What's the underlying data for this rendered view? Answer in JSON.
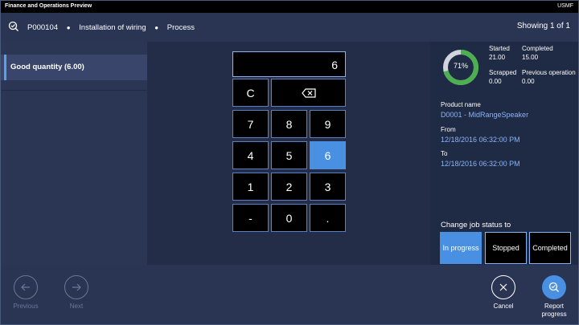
{
  "window": {
    "title": "Finance and Operations Preview",
    "company": "USMF"
  },
  "header": {
    "crumbs": [
      "P000104",
      "Installation of wiring",
      "Process"
    ],
    "showing": "Showing 1 of 1"
  },
  "left_panel": {
    "items": [
      {
        "label": "Good quantity (6.00)"
      }
    ]
  },
  "keypad": {
    "display": "6",
    "keys": {
      "clear": "C",
      "k7": "7",
      "k8": "8",
      "k9": "9",
      "k4": "4",
      "k5": "5",
      "k6": "6",
      "k1": "1",
      "k2": "2",
      "k3": "3",
      "minus": "-",
      "k0": "0",
      "dot": "."
    },
    "active_key": "6"
  },
  "progress": {
    "percent": 71,
    "percent_label": "71%",
    "ring_color": "#4caf50",
    "started_label": "Started",
    "started_value": "21.00",
    "completed_label": "Completed",
    "completed_value": "15.00",
    "scrapped_label": "Scrapped",
    "scrapped_value": "0.00",
    "previous_label": "Previous operation",
    "previous_value": "0.00"
  },
  "details": {
    "product_label": "Product name",
    "product_value": "D0001 - MidRangeSpeaker",
    "from_label": "From",
    "from_value": "12/18/2016 06:32:00 PM",
    "to_label": "To",
    "to_value": "12/18/2016 06:32:00 PM"
  },
  "job_status": {
    "label": "Change job status to",
    "options": [
      "In progress",
      "Stopped",
      "Completed"
    ],
    "selected": "In progress"
  },
  "footer": {
    "previous": "Previous",
    "next": "Next",
    "cancel": "Cancel",
    "report_line1": "Report",
    "report_line2": "progress"
  },
  "colors": {
    "accent": "#4a90e2",
    "link": "#8ab4f8",
    "success": "#4caf50"
  }
}
